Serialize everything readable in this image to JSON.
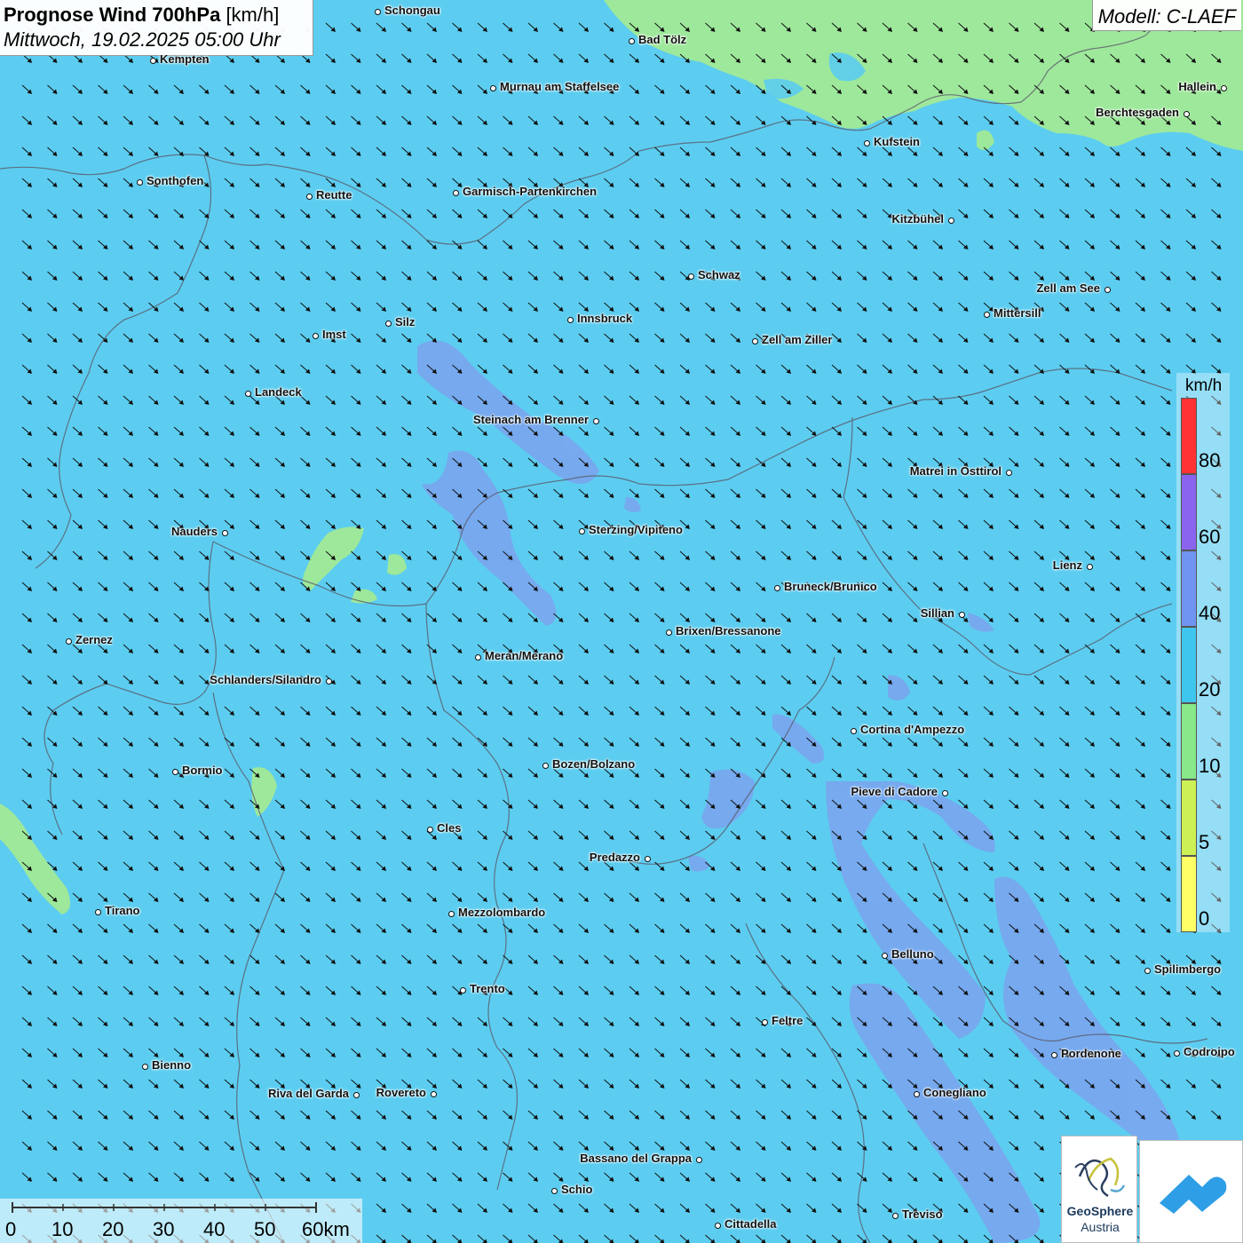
{
  "title": {
    "main_bold": "Prognose Wind 700hPa",
    "main_unit": "[km/h]",
    "subtitle": "Mittwoch, 19.02.2025 05:00 Uhr"
  },
  "model_label": "Modell: C-LAEF",
  "colors": {
    "sea_base": "#5ccdf0",
    "wind_20_40": "#5ccdf0",
    "wind_40_60": "#7b9ef0",
    "wind_10_20": "#9ae89a",
    "wind_5_10": "#c8f060",
    "arrows": "#111111",
    "borders": "#555555"
  },
  "legend": {
    "unit": "km/h",
    "bins": [
      {
        "label": "0",
        "color": "#ffff66"
      },
      {
        "label": "5",
        "color": "#ccf055"
      },
      {
        "label": "10",
        "color": "#88e88a"
      },
      {
        "label": "20",
        "color": "#3fc6ee"
      },
      {
        "label": "40",
        "color": "#6f95f0"
      },
      {
        "label": "60",
        "color": "#8a64ee"
      },
      {
        "label": "80",
        "color": "#ff3333"
      }
    ]
  },
  "scale_bar": {
    "ticks": [
      "0",
      "10",
      "20",
      "30",
      "40",
      "50",
      "60km"
    ]
  },
  "logos": {
    "geosphere_line1": "GeoSphere",
    "geosphere_line2": "Austria"
  },
  "wind_direction": "from northwest (arrows pointing southeast)",
  "cities": [
    {
      "name": "Schongau",
      "dot_side": "left"
    },
    {
      "name": "Bad Tölz",
      "dot_side": "left"
    },
    {
      "name": "Kempten",
      "dot_side": "left"
    },
    {
      "name": "Murnau am Staffelsee",
      "dot_side": "left"
    },
    {
      "name": "Hallein",
      "dot_side": "right"
    },
    {
      "name": "Berchtesgaden",
      "dot_side": "right"
    },
    {
      "name": "Kufstein",
      "dot_side": "left"
    },
    {
      "name": "Sonthofen",
      "dot_side": "left"
    },
    {
      "name": "Reutte",
      "dot_side": "left"
    },
    {
      "name": "Garmisch-Partenkirchen",
      "dot_side": "left"
    },
    {
      "name": "Kitzbühel",
      "dot_side": "right"
    },
    {
      "name": "Schwaz",
      "dot_side": "left"
    },
    {
      "name": "Zell am See",
      "dot_side": "right"
    },
    {
      "name": "Mittersill",
      "dot_side": "left"
    },
    {
      "name": "Innsbruck",
      "dot_side": "left"
    },
    {
      "name": "Silz",
      "dot_side": "left"
    },
    {
      "name": "Imst",
      "dot_side": "left"
    },
    {
      "name": "Zell am Ziller",
      "dot_side": "left"
    },
    {
      "name": "Landeck",
      "dot_side": "left"
    },
    {
      "name": "Steinach am Brenner",
      "dot_side": "right"
    },
    {
      "name": "Matrei in Osttirol",
      "dot_side": "right"
    },
    {
      "name": "Nauders",
      "dot_side": "right"
    },
    {
      "name": "Sterzing/Vipiteno",
      "dot_side": "left"
    },
    {
      "name": "Lienz",
      "dot_side": "right"
    },
    {
      "name": "Bruneck/Brunico",
      "dot_side": "left"
    },
    {
      "name": "Sillian",
      "dot_side": "right"
    },
    {
      "name": "Zernez",
      "dot_side": "left"
    },
    {
      "name": "Brixen/Bressanone",
      "dot_side": "left"
    },
    {
      "name": "Meran/Merano",
      "dot_side": "left"
    },
    {
      "name": "Schlanders/Silandro",
      "dot_side": "right"
    },
    {
      "name": "Cortina d'Ampezzo",
      "dot_side": "left"
    },
    {
      "name": "Bozen/Bolzano",
      "dot_side": "left"
    },
    {
      "name": "Bormio",
      "dot_side": "left"
    },
    {
      "name": "Pieve di Cadore",
      "dot_side": "right"
    },
    {
      "name": "Cles",
      "dot_side": "left"
    },
    {
      "name": "Predazzo",
      "dot_side": "right"
    },
    {
      "name": "Tirano",
      "dot_side": "left"
    },
    {
      "name": "Mezzolombardo",
      "dot_side": "left"
    },
    {
      "name": "Belluno",
      "dot_side": "left"
    },
    {
      "name": "Spilimbergo",
      "dot_side": "left"
    },
    {
      "name": "Trento",
      "dot_side": "left"
    },
    {
      "name": "Feltre",
      "dot_side": "left"
    },
    {
      "name": "Pordenone",
      "dot_side": "left"
    },
    {
      "name": "Codroipo",
      "dot_side": "left"
    },
    {
      "name": "Bienno",
      "dot_side": "left"
    },
    {
      "name": "Riva del Garda",
      "dot_side": "right"
    },
    {
      "name": "Rovereto",
      "dot_side": "right"
    },
    {
      "name": "Conegliano",
      "dot_side": "left"
    },
    {
      "name": "Bassano del Grappa",
      "dot_side": "right"
    },
    {
      "name": "Schio",
      "dot_side": "left"
    },
    {
      "name": "Treviso",
      "dot_side": "left"
    },
    {
      "name": "Cittadella",
      "dot_side": "left"
    }
  ]
}
